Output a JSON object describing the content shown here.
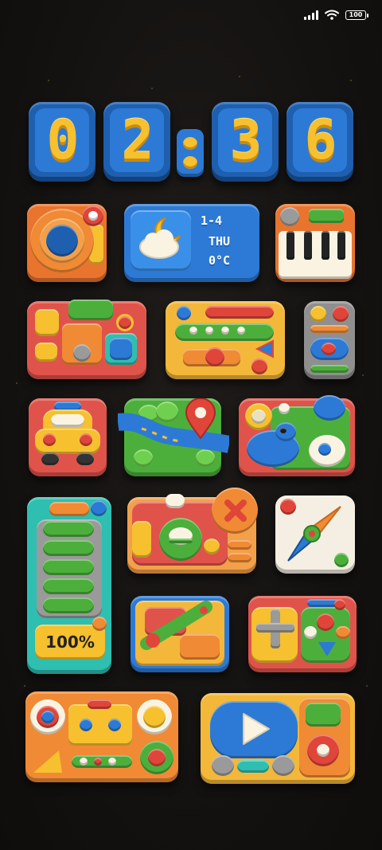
{
  "status_bar": {
    "signal_icon": "signal-bars-icon",
    "wifi_icon": "wifi-icon",
    "battery_level": "100"
  },
  "clock": {
    "hour_tens": "0",
    "hour_ones": "2",
    "minute_tens": "3",
    "minute_ones": "6"
  },
  "weather": {
    "date_range": "1-4",
    "weekday": "THU",
    "temperature": "0°C",
    "icon": "moon-cloud-icon"
  },
  "battery_widget": {
    "percent": "100%",
    "level": 1.0
  },
  "apps": [
    {
      "name": "camera-app-icon"
    },
    {
      "name": "piano-app-icon"
    },
    {
      "name": "toolbox-app-icon"
    },
    {
      "name": "radio-app-icon"
    },
    {
      "name": "remote-app-icon"
    },
    {
      "name": "taxi-app-icon"
    },
    {
      "name": "maps-app-icon"
    },
    {
      "name": "twitter-app-icon"
    },
    {
      "name": "browser-app-icon"
    },
    {
      "name": "compass-app-icon"
    },
    {
      "name": "ruler-app-icon"
    },
    {
      "name": "gamepad-app-icon"
    },
    {
      "name": "cassette-app-icon"
    },
    {
      "name": "video-player-app-icon"
    }
  ],
  "colors": {
    "clay_blue": "#2c7ad6",
    "clay_yellow": "#f6c02e",
    "clay_orange": "#f08a35",
    "clay_green": "#4caf3c",
    "clay_red": "#e0453a",
    "background": "#141210"
  }
}
